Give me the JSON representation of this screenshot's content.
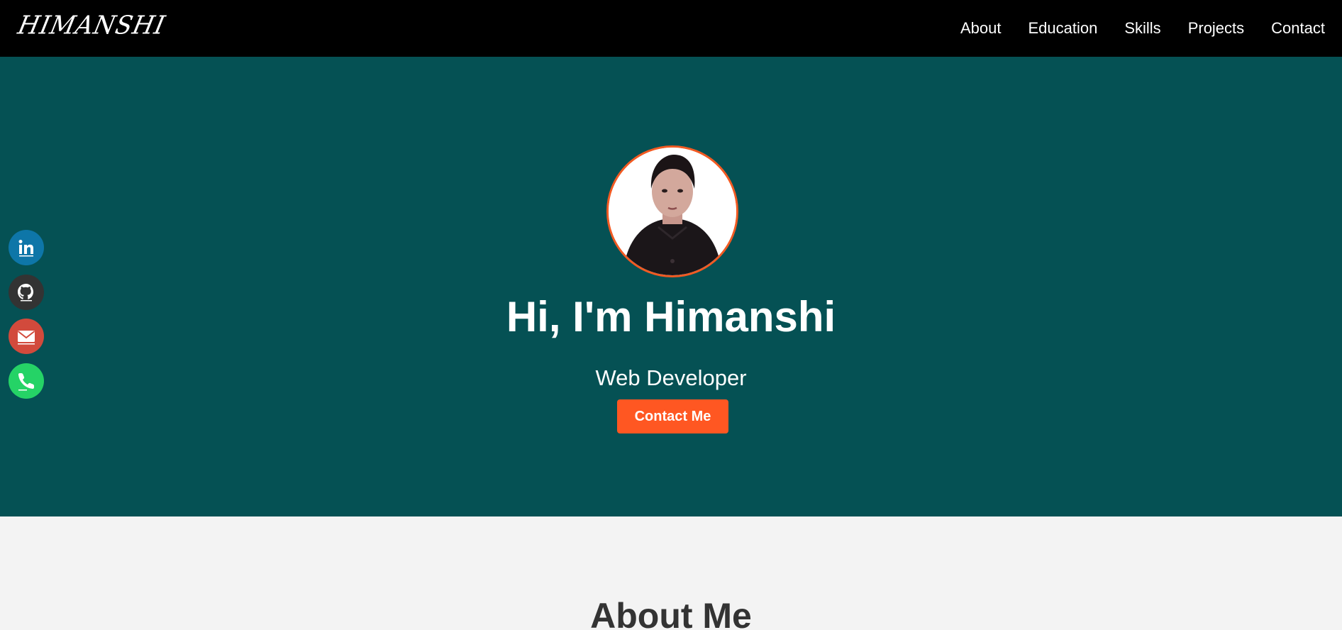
{
  "navbar": {
    "logo": "HIMANSHI",
    "links": [
      "About",
      "Education",
      "Skills",
      "Projects",
      "Contact"
    ]
  },
  "hero": {
    "title": "Hi, I'm Himanshi",
    "subtitle": "Web Developer",
    "cta_label": "Contact Me"
  },
  "social": [
    {
      "icon": "linkedin-icon",
      "color": "#0e76a8"
    },
    {
      "icon": "github-icon",
      "color": "#333333"
    },
    {
      "icon": "email-icon",
      "color": "#d24a3c"
    },
    {
      "icon": "whatsapp-icon",
      "color": "#25d366"
    }
  ],
  "about": {
    "title": "About Me"
  },
  "colors": {
    "navbar_bg": "#000000",
    "hero_bg": "#055154",
    "accent": "#ff5722",
    "section_bg": "#f3f3f3"
  }
}
